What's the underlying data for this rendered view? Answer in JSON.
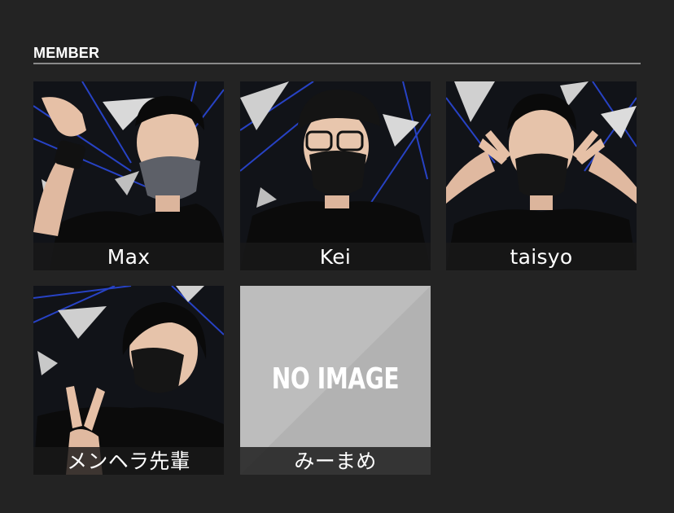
{
  "section": {
    "title": "MEMBER"
  },
  "members": [
    {
      "name": "Max",
      "icon": "member-photo-max"
    },
    {
      "name": "Kei",
      "icon": "member-photo-kei"
    },
    {
      "name": "taisyo",
      "icon": "member-photo-taisyo"
    },
    {
      "name": "メンヘラ先輩",
      "icon": "member-photo-menhera-senpai"
    },
    {
      "name": "みーまめ",
      "icon": "no-image-placeholder",
      "placeholder_text": "NO IMAGE"
    }
  ],
  "colors": {
    "background": "#232323",
    "rule": "#8a8a8a",
    "placeholder": "#bdbdbd",
    "accent_blue": "#2b4bd6"
  }
}
